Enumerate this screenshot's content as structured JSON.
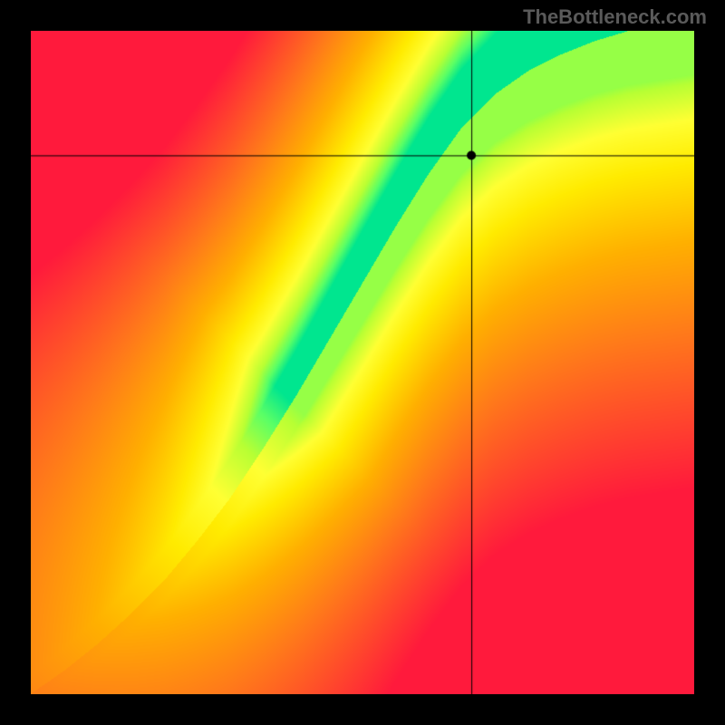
{
  "watermark_text": "TheBottleneck.com",
  "chart_data": {
    "type": "heatmap",
    "title": "",
    "xlabel": "",
    "ylabel": "",
    "xlim": [
      0,
      1
    ],
    "ylim": [
      0,
      1
    ],
    "marker": {
      "x": 0.665,
      "y": 0.812
    },
    "crosshair_x": 0.665,
    "crosshair_y": 0.812,
    "ridge": [
      {
        "x": 0.0,
        "y": 0.0,
        "width": 0.01
      },
      {
        "x": 0.05,
        "y": 0.035,
        "width": 0.015
      },
      {
        "x": 0.1,
        "y": 0.075,
        "width": 0.02
      },
      {
        "x": 0.15,
        "y": 0.12,
        "width": 0.025
      },
      {
        "x": 0.2,
        "y": 0.17,
        "width": 0.03
      },
      {
        "x": 0.25,
        "y": 0.23,
        "width": 0.035
      },
      {
        "x": 0.3,
        "y": 0.295,
        "width": 0.04
      },
      {
        "x": 0.35,
        "y": 0.37,
        "width": 0.045
      },
      {
        "x": 0.4,
        "y": 0.45,
        "width": 0.05
      },
      {
        "x": 0.45,
        "y": 0.535,
        "width": 0.055
      },
      {
        "x": 0.5,
        "y": 0.62,
        "width": 0.06
      },
      {
        "x": 0.55,
        "y": 0.705,
        "width": 0.063
      },
      {
        "x": 0.6,
        "y": 0.785,
        "width": 0.066
      },
      {
        "x": 0.65,
        "y": 0.855,
        "width": 0.069
      },
      {
        "x": 0.7,
        "y": 0.905,
        "width": 0.072
      },
      {
        "x": 0.75,
        "y": 0.94,
        "width": 0.075
      },
      {
        "x": 0.8,
        "y": 0.965,
        "width": 0.077
      },
      {
        "x": 0.85,
        "y": 0.985,
        "width": 0.079
      },
      {
        "x": 0.9,
        "y": 1.0,
        "width": 0.081
      },
      {
        "x": 1.0,
        "y": 1.02,
        "width": 0.085
      }
    ],
    "palette": [
      {
        "t": 0.0,
        "color": "#ff1a3c"
      },
      {
        "t": 0.35,
        "color": "#ff7a1a"
      },
      {
        "t": 0.55,
        "color": "#ffb000"
      },
      {
        "t": 0.72,
        "color": "#ffeb00"
      },
      {
        "t": 0.82,
        "color": "#ffff33"
      },
      {
        "t": 0.9,
        "color": "#b8ff33"
      },
      {
        "t": 0.955,
        "color": "#5aff66"
      },
      {
        "t": 1.0,
        "color": "#00e68f"
      }
    ],
    "description": "Heatmap with a diagonal optimal band (green) running from lower-left to upper-right. Color encodes proximity to the optimal ridge: green = optimal, yellow = near, orange/red = far. A black crosshair marks a sample point near the upper portion of the ridge."
  }
}
